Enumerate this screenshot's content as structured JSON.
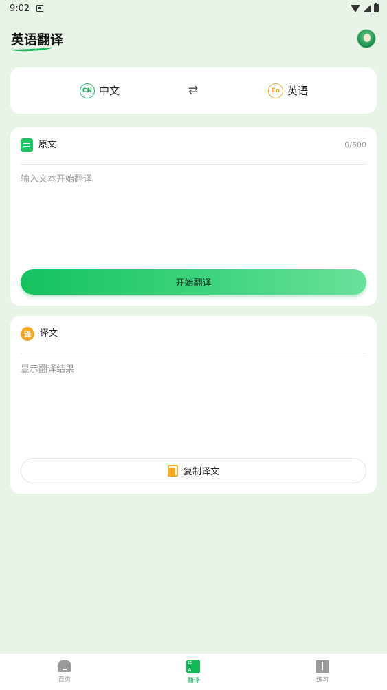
{
  "status_bar": {
    "time": "9:02"
  },
  "header": {
    "title": "英语翻译",
    "avatar_icon": "avatar-icon"
  },
  "language_selector": {
    "source_badge": "CN",
    "source_label": "中文",
    "swap_symbol": "⇄",
    "target_badge": "En",
    "target_label": "英语"
  },
  "source_panel": {
    "title": "原文",
    "char_count": "0/500",
    "input_value": "",
    "input_placeholder": "输入文本开始翻译",
    "translate_button": "开始翻译"
  },
  "result_panel": {
    "badge": "译",
    "title": "译文",
    "placeholder": "显示翻译结果",
    "copy_button": "复制译文"
  },
  "bottom_nav": {
    "items": [
      {
        "label": "首页",
        "icon": "home-icon",
        "active": false
      },
      {
        "label": "翻译",
        "icon": "translate-icon",
        "active": true
      },
      {
        "label": "练习",
        "icon": "book-icon",
        "active": false
      }
    ]
  },
  "colors": {
    "background": "#e9f4e9",
    "primary_green": "#13b957",
    "accent_orange": "#f5a623",
    "card": "#ffffff"
  }
}
